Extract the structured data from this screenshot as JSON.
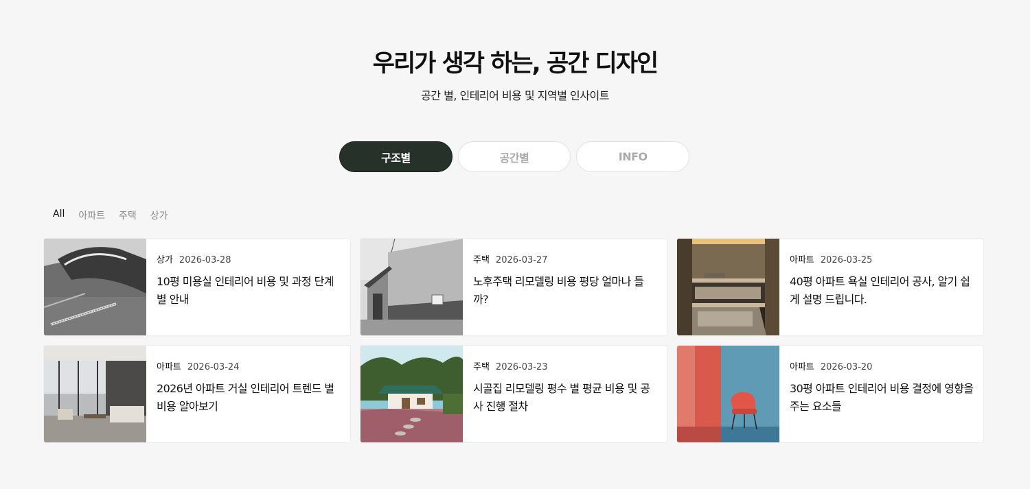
{
  "hero": {
    "title": "우리가 생각 하는, 공간 디자인",
    "subtitle": "공간 별, 인테리어 비용 및 지역별 인사이트"
  },
  "tabs": [
    {
      "label": "구조별",
      "active": true
    },
    {
      "label": "공간별",
      "active": false
    },
    {
      "label": "INFO",
      "active": false
    }
  ],
  "filters": [
    {
      "label": "All",
      "active": true
    },
    {
      "label": "아파트",
      "active": false
    },
    {
      "label": "주택",
      "active": false
    },
    {
      "label": "상가",
      "active": false
    }
  ],
  "cards": [
    {
      "category": "상가",
      "date": "2026-03-28",
      "title": "10평 미용실 인테리어 비용 및 과정 단계별 안내"
    },
    {
      "category": "주택",
      "date": "2026-03-27",
      "title": "노후주택 리모델링 비용 평당 얼마나 들까?"
    },
    {
      "category": "아파트",
      "date": "2026-03-25",
      "title": "40평 아파트 욕실 인테리어 공사, 알기 쉽게 설명 드립니다."
    },
    {
      "category": "아파트",
      "date": "2026-03-24",
      "title": "2026년 아파트 거실 인테리어 트렌드 별 비용 알아보기"
    },
    {
      "category": "주택",
      "date": "2026-03-23",
      "title": "시골집 리모델링 평수 별 평균 비용 및 공사 진행 절차"
    },
    {
      "category": "아파트",
      "date": "2026-03-20",
      "title": "30평 아파트 인테리어 비용 결정에 영향을 주는 요소들"
    }
  ],
  "colors": {
    "background": "#f6f6f6",
    "active_tab": "#263129",
    "card": "#ffffff"
  }
}
